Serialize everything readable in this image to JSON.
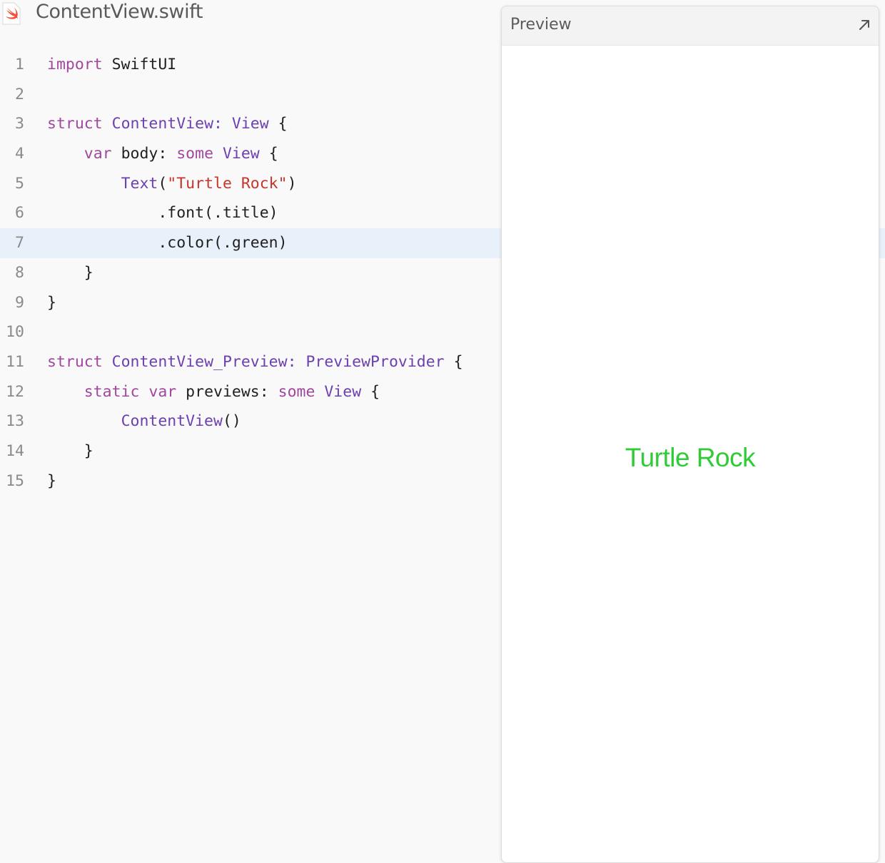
{
  "tab": {
    "filename": "ContentView.swift",
    "icon": "swift-file-icon"
  },
  "editor": {
    "active_line": 7,
    "lines": [
      {
        "n": "1",
        "tokens": [
          [
            "kw",
            "import"
          ],
          [
            "p",
            " SwiftUI"
          ]
        ]
      },
      {
        "n": "2",
        "tokens": []
      },
      {
        "n": "3",
        "tokens": [
          [
            "kw",
            "struct"
          ],
          [
            "p",
            " "
          ],
          [
            "ty",
            "ContentView: View"
          ],
          [
            "p",
            " {"
          ]
        ]
      },
      {
        "n": "4",
        "tokens": [
          [
            "p",
            "    "
          ],
          [
            "kw",
            "var"
          ],
          [
            "p",
            " body: "
          ],
          [
            "kw",
            "some"
          ],
          [
            "p",
            " "
          ],
          [
            "ty",
            "View"
          ],
          [
            "p",
            " {"
          ]
        ]
      },
      {
        "n": "5",
        "tokens": [
          [
            "p",
            "        "
          ],
          [
            "ty",
            "Text"
          ],
          [
            "p",
            "("
          ],
          [
            "str",
            "\"Turtle Rock\""
          ],
          [
            "p",
            ")"
          ]
        ]
      },
      {
        "n": "6",
        "tokens": [
          [
            "p",
            "            .font(.title)"
          ]
        ]
      },
      {
        "n": "7",
        "tokens": [
          [
            "p",
            "            .color(.green)"
          ]
        ]
      },
      {
        "n": "8",
        "tokens": [
          [
            "p",
            "    }"
          ]
        ]
      },
      {
        "n": "9",
        "tokens": [
          [
            "p",
            "}"
          ]
        ]
      },
      {
        "n": "10",
        "tokens": []
      },
      {
        "n": "11",
        "tokens": [
          [
            "kw",
            "struct"
          ],
          [
            "p",
            " "
          ],
          [
            "ty",
            "ContentView_Preview: PreviewProvider"
          ],
          [
            "p",
            " {"
          ]
        ]
      },
      {
        "n": "12",
        "tokens": [
          [
            "p",
            "    "
          ],
          [
            "kw",
            "static var"
          ],
          [
            "p",
            " previews: "
          ],
          [
            "kw",
            "some"
          ],
          [
            "p",
            " "
          ],
          [
            "ty",
            "View"
          ],
          [
            "p",
            " {"
          ]
        ]
      },
      {
        "n": "13",
        "tokens": [
          [
            "p",
            "        "
          ],
          [
            "ty",
            "ContentView"
          ],
          [
            "p",
            "()"
          ]
        ]
      },
      {
        "n": "14",
        "tokens": [
          [
            "p",
            "    }"
          ]
        ]
      },
      {
        "n": "15",
        "tokens": [
          [
            "p",
            "}"
          ]
        ]
      }
    ]
  },
  "preview": {
    "title": "Preview",
    "expand_icon": "expand-arrow-icon",
    "rendered_text": "Turtle Rock",
    "rendered_text_color": "#2fcc35"
  }
}
